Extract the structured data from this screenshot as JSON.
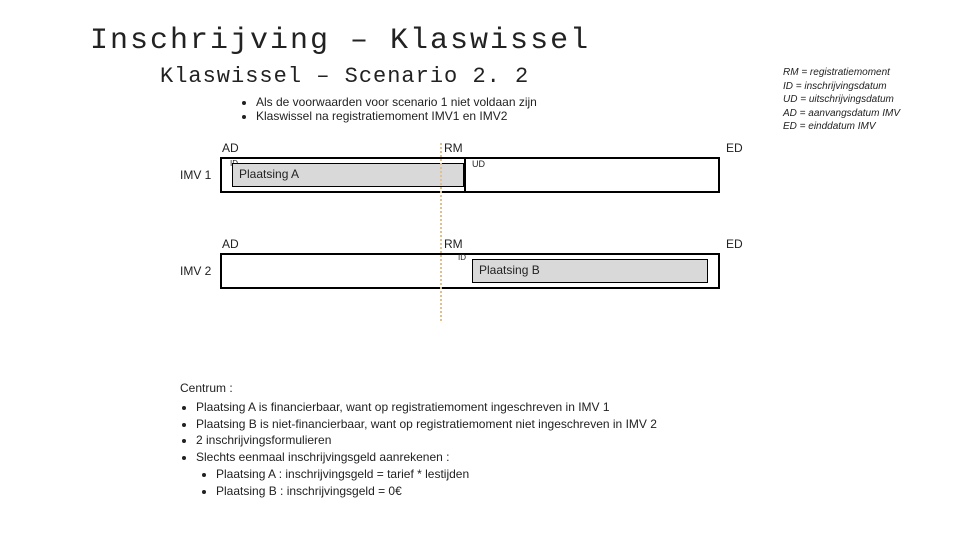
{
  "title": "Inschrijving – Klaswissel",
  "subtitle": "Klaswissel – Scenario 2. 2",
  "legend": {
    "rm": "RM = registratiemoment",
    "id": "ID = inschrijvingsdatum",
    "ud": "UD = uitschrijvingsdatum",
    "ad": "AD = aanvangsdatum IMV",
    "ed": "ED = einddatum IMV"
  },
  "conditions": [
    "Als de voorwaarden voor scenario 1 niet voldaan zijn",
    "Klaswissel na registratiemoment IMV1 en IMV2"
  ],
  "diagram": {
    "row1": {
      "name": "IMV 1",
      "ad": "AD",
      "rm": "RM",
      "ed": "ED",
      "id": "ID",
      "ud": "UD",
      "placing": "Plaatsing A"
    },
    "row2": {
      "name": "IMV 2",
      "ad": "AD",
      "rm": "RM",
      "ed": "ED",
      "id": "ID",
      "placing": "Plaatsing B"
    }
  },
  "notes": {
    "heading": "Centrum :",
    "items": [
      "Plaatsing A is financierbaar, want op registratiemoment ingeschreven in IMV 1",
      "Plaatsing B is niet-financierbaar, want op registratiemoment niet ingeschreven in IMV 2",
      "2 inschrijvingsformulieren",
      "Slechts eenmaal inschrijvingsgeld aanrekenen :"
    ],
    "sub": [
      "Plaatsing A : inschrijvingsgeld = tarief * lestijden",
      "Plaatsing B : inschrijvingsgeld = 0€"
    ]
  }
}
